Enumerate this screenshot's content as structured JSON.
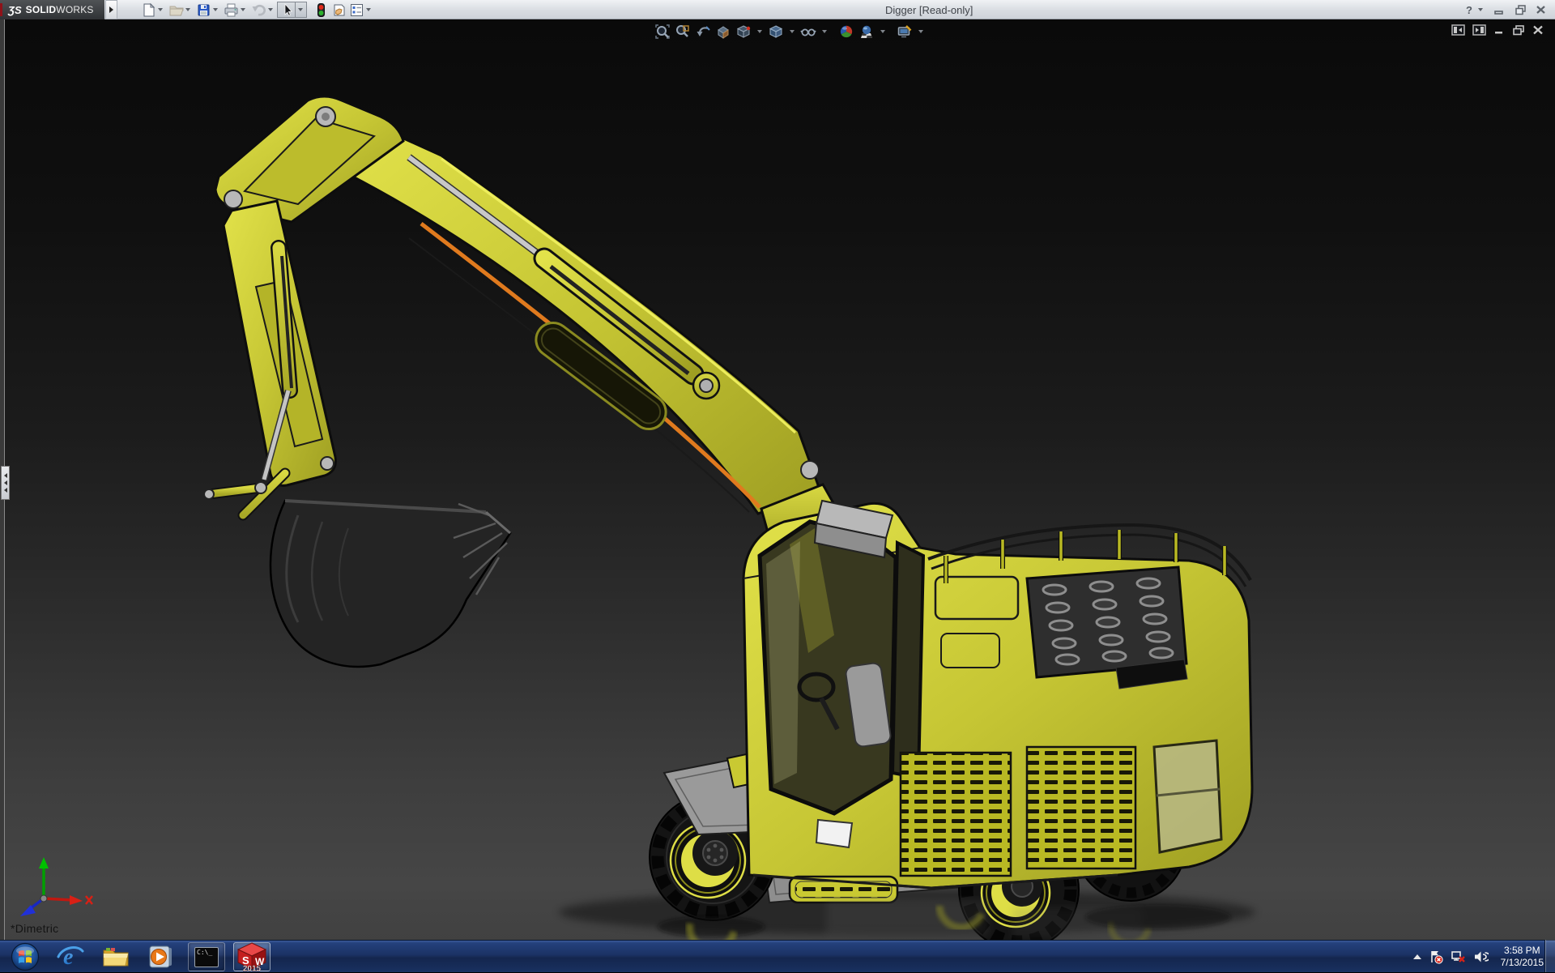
{
  "titlebar": {
    "brand_glyph": "ƷS",
    "brand_solid": "SOLID",
    "brand_works": "WORKS",
    "title": "Digger [Read-only]",
    "help_glyph": "?",
    "tools": [
      "menu-flyout",
      "new",
      "open",
      "save",
      "print",
      "undo",
      "select",
      "rebuild",
      "file-properties",
      "options"
    ],
    "window_buttons": [
      "help",
      "minimize",
      "restore",
      "close"
    ]
  },
  "viewport": {
    "model_name": "Digger",
    "orientation_label": "*Dimetric",
    "headsup_tools": [
      "zoom-to-fit",
      "zoom-to-area",
      "previous-view",
      "section-view",
      "view-orientation",
      "display-style",
      "hide-show-items",
      "edit-appearance",
      "apply-scene",
      "view-settings"
    ],
    "doc_window_buttons": [
      "previous-pane",
      "next-pane",
      "minimize",
      "restore",
      "close"
    ],
    "triad_axes": [
      "x-red",
      "y-green",
      "z-blue"
    ]
  },
  "taskbar": {
    "apps": [
      "start",
      "internet-explorer",
      "windows-explorer",
      "media-player",
      "command-prompt",
      "solidworks-2015"
    ],
    "ie_glyph": "e",
    "cmd_icon_text": "C:\\_",
    "sw_logo": {
      "s": "S",
      "w": "W",
      "year": "2015"
    },
    "tray": {
      "icons": [
        "hidden-icons",
        "action-center",
        "network-error",
        "volume"
      ],
      "clock": {
        "time": "3:58 PM",
        "date": "7/13/2015"
      }
    }
  },
  "colors": {
    "model_yellow": "#c9c932",
    "model_orange": "#e07a1e",
    "titlebar_bg": "#d9dde2",
    "taskbar_blue": "#1b3264",
    "brand_red": "#8f1219",
    "viewport_dark": "#0a0a0a"
  }
}
